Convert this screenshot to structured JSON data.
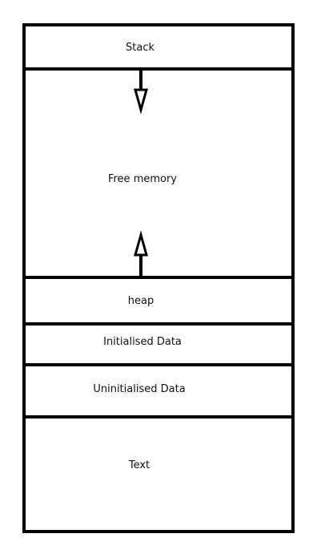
{
  "memory_layout": {
    "segments": [
      {
        "id": "stack",
        "label": "Stack"
      },
      {
        "id": "free",
        "label": "Free memory"
      },
      {
        "id": "heap",
        "label": "heap"
      },
      {
        "id": "initialised",
        "label": "Initialised Data"
      },
      {
        "id": "uninitialised",
        "label": "Uninitialised Data"
      },
      {
        "id": "text",
        "label": "Text"
      }
    ],
    "arrows": [
      {
        "id": "stack-growth",
        "direction": "down"
      },
      {
        "id": "heap-growth",
        "direction": "up"
      }
    ]
  }
}
